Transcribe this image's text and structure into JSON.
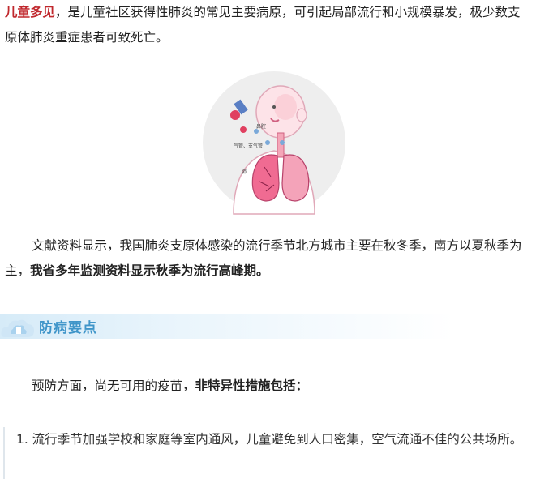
{
  "intro": {
    "highlight": "儿童多见",
    "text": "，是儿童社区获得性肺炎的常见主要病原，可引起局部流行和小规模暴发，极少数支原体肺炎重症患者可致死亡。"
  },
  "illustration": {
    "labels": [
      "鼻腔",
      "气管、支气管",
      "肺"
    ]
  },
  "paragraph2": {
    "text": "文献资料显示，我国肺炎支原体感染的流行季节北方城市主要在秋冬季，南方以夏秋季为主，",
    "bold": "我省多年监测资料显示秋季为流行高峰期。"
  },
  "section": {
    "title": "防病要点"
  },
  "paragraph3": {
    "text": "预防方面，尚无可用的疫苗，",
    "bold": "非特异性措施包括："
  },
  "measures": [
    {
      "text": "1. 流行季节加强学校和家庭等室内通风，儿童避免到人口密集，空气流通不佳的公共场所。"
    }
  ],
  "colors": {
    "highlight": "#c0282d",
    "section_title": "#3f95c9",
    "section_bar": "#d6ebf8"
  }
}
